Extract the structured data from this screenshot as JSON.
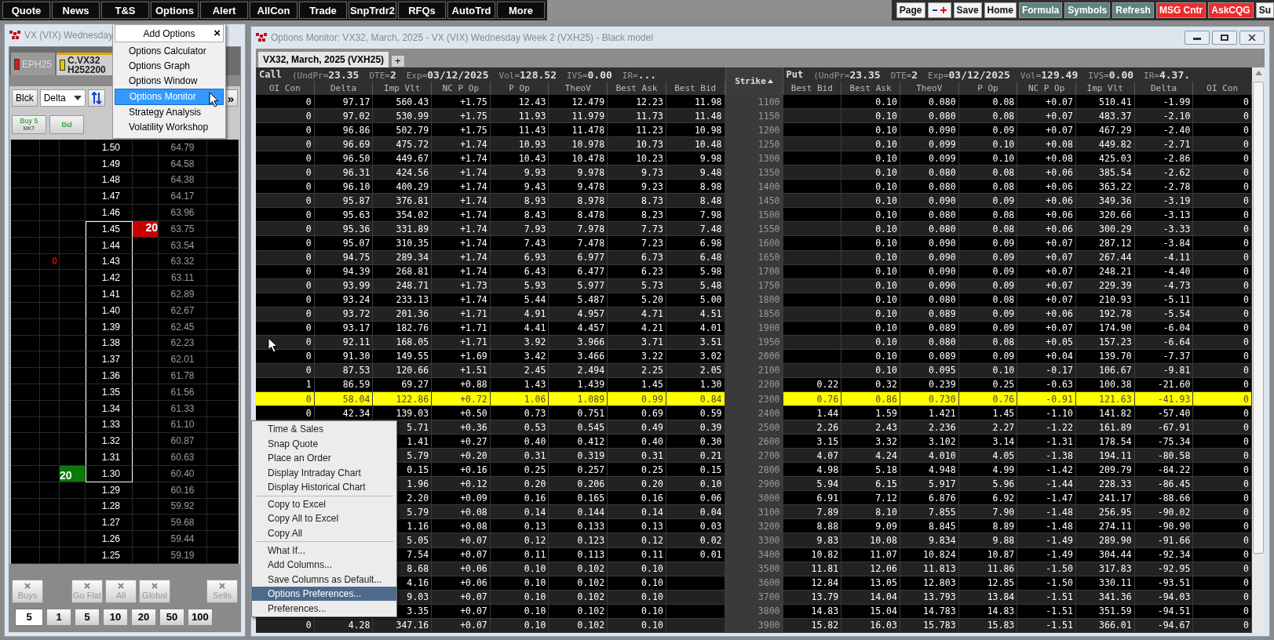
{
  "toolbar": {
    "left": [
      "Quote",
      "News",
      "T&S",
      "Options",
      "Alert",
      "AllCon",
      "Trade",
      "SnpTrdr2",
      "RFQs",
      "AutoTrd",
      "More"
    ],
    "right": [
      {
        "kind": "plain",
        "label": "Page"
      },
      {
        "kind": "plusminus"
      },
      {
        "kind": "plain",
        "label": "Save"
      },
      {
        "kind": "plain",
        "label": "Home"
      },
      {
        "kind": "teal",
        "label": "Formula"
      },
      {
        "kind": "teal",
        "label": "Symbols"
      },
      {
        "kind": "teal",
        "label": "Refresh"
      },
      {
        "kind": "alert",
        "label": "MSG Cntr"
      },
      {
        "kind": "alert",
        "label": "AskCQG"
      },
      {
        "kind": "plain",
        "label": "Su"
      }
    ]
  },
  "dom_window": {
    "title": "VX (VIX) Wednesday",
    "tabs": [
      {
        "label": "EPH25",
        "selected": false,
        "color": "#d02020"
      },
      {
        "label": "C.VX32 H252200",
        "selected": true,
        "color": "#e8c800"
      }
    ],
    "controls": [
      {
        "kind": "button",
        "label": "Blck"
      },
      {
        "kind": "dropdown",
        "label": "Delta"
      },
      {
        "kind": "icon"
      },
      {
        "kind": "more",
        "label": "»"
      }
    ],
    "order_buttons": [
      {
        "label": "Buy 5",
        "sub": "MKT"
      },
      {
        "label": "Bid"
      }
    ],
    "ladder": [
      {
        "price": "1.50",
        "column_6": "64.79",
        "bracketed": false
      },
      {
        "price": "1.49",
        "column_6": "64.58",
        "bracketed": false
      },
      {
        "price": "1.48",
        "column_6": "64.38",
        "bracketed": false
      },
      {
        "price": "1.47",
        "column_6": "64.17",
        "bracketed": false
      },
      {
        "price": "1.46",
        "column_6": "63.96",
        "bracketed": false
      },
      {
        "price": "1.45",
        "sell": "20",
        "column_6": "63.75",
        "bracketed": true
      },
      {
        "price": "1.44",
        "column_6": "63.54",
        "bracketed": true
      },
      {
        "price": "1.43",
        "column_2": "0",
        "column_6": "63.32",
        "bracketed": true
      },
      {
        "price": "1.42",
        "column_6": "63.11",
        "bracketed": true
      },
      {
        "price": "1.41",
        "column_6": "62.89",
        "bracketed": true
      },
      {
        "price": "1.40",
        "column_6": "62.67",
        "bracketed": true
      },
      {
        "price": "1.39",
        "column_6": "62.45",
        "bracketed": true
      },
      {
        "price": "1.38",
        "column_6": "62.23",
        "bracketed": true
      },
      {
        "price": "1.37",
        "column_6": "62.01",
        "bracketed": true
      },
      {
        "price": "1.36",
        "column_6": "61.78",
        "bracketed": true
      },
      {
        "price": "1.35",
        "column_6": "61.56",
        "bracketed": true
      },
      {
        "price": "1.34",
        "column_6": "61.33",
        "bracketed": true
      },
      {
        "price": "1.33",
        "column_6": "61.10",
        "bracketed": true
      },
      {
        "price": "1.32",
        "column_6": "60.87",
        "bracketed": true
      },
      {
        "price": "1.31",
        "column_6": "60.63",
        "bracketed": true
      },
      {
        "price": "1.30",
        "buy": "20",
        "column_6": "60.40",
        "bracketed": true
      },
      {
        "price": "1.29",
        "column_6": "60.16",
        "bracketed": false
      },
      {
        "price": "1.28",
        "column_6": "59.92",
        "bracketed": false
      },
      {
        "price": "1.27",
        "column_6": "59.68",
        "bracketed": false
      },
      {
        "price": "1.26",
        "column_6": "59.44",
        "bracketed": false
      },
      {
        "price": "1.25",
        "column_6": "59.19",
        "bracketed": false
      }
    ],
    "cancel_buttons": [
      "Buys",
      "Go Flat",
      "All",
      "Global",
      "Sells"
    ],
    "quantity": {
      "value": "5"
    },
    "quantity_buttons": [
      "1",
      "5",
      "10",
      "20",
      "50",
      "100"
    ]
  },
  "add_options_menu": {
    "title": "Add Options",
    "close": "×",
    "items": [
      {
        "label": "Options Calculator",
        "selected": false
      },
      {
        "label": "Options Graph",
        "selected": false
      },
      {
        "label": "Options Window",
        "selected": false
      },
      {
        "label": "Options Monitor",
        "selected": true
      },
      {
        "label": "Strategy Analysis",
        "selected": false
      },
      {
        "label": "Volatility Workshop",
        "selected": false
      }
    ]
  },
  "monitor": {
    "title": "Options Monitor: VX32, March, 2025 - VX (VIX) Wednesday Week 2 (VXH25) - Black model",
    "tabs": [
      {
        "label": "VX32, March, 2025 (VXH25)",
        "selected": true
      }
    ],
    "add_tab": "+",
    "call_header": {
      "label": "Call",
      "info": [
        "(UndPr=**23.35**",
        "DTE=**2**",
        "Exp=**03/12/2025**",
        "Vol=**128.52**",
        "IVS=**0.00**",
        "IR=**...**"
      ]
    },
    "put_header": {
      "label": "Put",
      "info": [
        "(UndPr=**23.35**",
        "DTE=**2**",
        "Exp=**03/12/2025**",
        "Vol=**129.49**",
        "IVS=**0.00**",
        "IR=**4.37.**"
      ]
    },
    "call_columns": [
      "OI Con",
      "Delta",
      "Imp Vlt",
      "NC P Op",
      "P Op",
      "TheoV",
      "Best Ask",
      "Best Bid"
    ],
    "strike_column": "Strike",
    "put_columns": [
      "Best Bid",
      "Best Ask",
      "TheoV",
      "P Op",
      "NC P Op",
      "Imp Vlt",
      "Delta",
      "OI Con"
    ],
    "rows": [
      {
        "strike": "1100",
        "atm": false,
        "call": {
          "oi": "0",
          "delta": "97.17",
          "iv": "560.43",
          "ncp": "+1.75",
          "pop": "12.43",
          "theo": "12.479",
          "ask": "12.23",
          "bid": "11.98"
        },
        "put": {
          "ask": "0.10",
          "theo": "0.080",
          "pop": "0.08",
          "ncp": "+0.07",
          "iv": "510.41",
          "delta": "-1.99",
          "oi": "0"
        }
      },
      {
        "strike": "1150",
        "atm": false,
        "call": {
          "oi": "0",
          "delta": "97.02",
          "iv": "530.99",
          "ncp": "+1.75",
          "pop": "11.93",
          "theo": "11.979",
          "ask": "11.73",
          "bid": "11.48"
        },
        "put": {
          "ask": "0.10",
          "theo": "0.080",
          "pop": "0.08",
          "ncp": "+0.07",
          "iv": "483.37",
          "delta": "-2.10",
          "oi": "0"
        }
      },
      {
        "strike": "1200",
        "atm": false,
        "call": {
          "oi": "0",
          "delta": "96.86",
          "iv": "502.79",
          "ncp": "+1.75",
          "pop": "11.43",
          "theo": "11.478",
          "ask": "11.23",
          "bid": "10.98"
        },
        "put": {
          "ask": "0.10",
          "theo": "0.090",
          "pop": "0.09",
          "ncp": "+0.07",
          "iv": "467.29",
          "delta": "-2.40",
          "oi": "0"
        }
      },
      {
        "strike": "1250",
        "atm": false,
        "call": {
          "oi": "0",
          "delta": "96.69",
          "iv": "475.72",
          "ncp": "+1.74",
          "pop": "10.93",
          "theo": "10.978",
          "ask": "10.73",
          "bid": "10.48"
        },
        "put": {
          "ask": "0.10",
          "theo": "0.099",
          "pop": "0.10",
          "ncp": "+0.08",
          "iv": "449.82",
          "delta": "-2.71",
          "oi": "0"
        }
      },
      {
        "strike": "1300",
        "atm": false,
        "call": {
          "oi": "0",
          "delta": "96.50",
          "iv": "449.67",
          "ncp": "+1.74",
          "pop": "10.43",
          "theo": "10.478",
          "ask": "10.23",
          "bid": "9.98"
        },
        "put": {
          "ask": "0.10",
          "theo": "0.099",
          "pop": "0.10",
          "ncp": "+0.08",
          "iv": "425.03",
          "delta": "-2.86",
          "oi": "0"
        }
      },
      {
        "strike": "1350",
        "atm": false,
        "call": {
          "oi": "0",
          "delta": "96.31",
          "iv": "424.56",
          "ncp": "+1.74",
          "pop": "9.93",
          "theo": "9.978",
          "ask": "9.73",
          "bid": "9.48"
        },
        "put": {
          "ask": "0.10",
          "theo": "0.080",
          "pop": "0.08",
          "ncp": "+0.06",
          "iv": "385.54",
          "delta": "-2.62",
          "oi": "0"
        }
      },
      {
        "strike": "1400",
        "atm": false,
        "call": {
          "oi": "0",
          "delta": "96.10",
          "iv": "400.29",
          "ncp": "+1.74",
          "pop": "9.43",
          "theo": "9.478",
          "ask": "9.23",
          "bid": "8.98"
        },
        "put": {
          "ask": "0.10",
          "theo": "0.080",
          "pop": "0.08",
          "ncp": "+0.06",
          "iv": "363.22",
          "delta": "-2.78",
          "oi": "0"
        }
      },
      {
        "strike": "1450",
        "atm": false,
        "call": {
          "oi": "0",
          "delta": "95.87",
          "iv": "376.81",
          "ncp": "+1.74",
          "pop": "8.93",
          "theo": "8.978",
          "ask": "8.73",
          "bid": "8.48"
        },
        "put": {
          "ask": "0.10",
          "theo": "0.090",
          "pop": "0.09",
          "ncp": "+0.06",
          "iv": "349.36",
          "delta": "-3.19",
          "oi": "0"
        }
      },
      {
        "strike": "1500",
        "atm": false,
        "call": {
          "oi": "0",
          "delta": "95.63",
          "iv": "354.02",
          "ncp": "+1.74",
          "pop": "8.43",
          "theo": "8.478",
          "ask": "8.23",
          "bid": "7.98"
        },
        "put": {
          "ask": "0.10",
          "theo": "0.080",
          "pop": "0.08",
          "ncp": "+0.06",
          "iv": "320.66",
          "delta": "-3.13",
          "oi": "0"
        }
      },
      {
        "strike": "1550",
        "atm": false,
        "call": {
          "oi": "0",
          "delta": "95.36",
          "iv": "331.89",
          "ncp": "+1.74",
          "pop": "7.93",
          "theo": "7.978",
          "ask": "7.73",
          "bid": "7.48"
        },
        "put": {
          "ask": "0.10",
          "theo": "0.080",
          "pop": "0.08",
          "ncp": "+0.06",
          "iv": "300.29",
          "delta": "-3.33",
          "oi": "0"
        }
      },
      {
        "strike": "1600",
        "atm": false,
        "call": {
          "oi": "0",
          "delta": "95.07",
          "iv": "310.35",
          "ncp": "+1.74",
          "pop": "7.43",
          "theo": "7.478",
          "ask": "7.23",
          "bid": "6.98"
        },
        "put": {
          "ask": "0.10",
          "theo": "0.090",
          "pop": "0.09",
          "ncp": "+0.07",
          "iv": "287.12",
          "delta": "-3.84",
          "oi": "0"
        }
      },
      {
        "strike": "1650",
        "atm": false,
        "call": {
          "oi": "0",
          "delta": "94.75",
          "iv": "289.34",
          "ncp": "+1.74",
          "pop": "6.93",
          "theo": "6.977",
          "ask": "6.73",
          "bid": "6.48"
        },
        "put": {
          "ask": "0.10",
          "theo": "0.090",
          "pop": "0.09",
          "ncp": "+0.07",
          "iv": "267.44",
          "delta": "-4.11",
          "oi": "0"
        }
      },
      {
        "strike": "1700",
        "atm": false,
        "call": {
          "oi": "0",
          "delta": "94.39",
          "iv": "268.81",
          "ncp": "+1.74",
          "pop": "6.43",
          "theo": "6.477",
          "ask": "6.23",
          "bid": "5.98"
        },
        "put": {
          "ask": "0.10",
          "theo": "0.090",
          "pop": "0.09",
          "ncp": "+0.07",
          "iv": "248.21",
          "delta": "-4.40",
          "oi": "0"
        }
      },
      {
        "strike": "1750",
        "atm": false,
        "call": {
          "oi": "0",
          "delta": "93.99",
          "iv": "248.71",
          "ncp": "+1.73",
          "pop": "5.93",
          "theo": "5.977",
          "ask": "5.73",
          "bid": "5.48"
        },
        "put": {
          "ask": "0.10",
          "theo": "0.090",
          "pop": "0.09",
          "ncp": "+0.07",
          "iv": "229.39",
          "delta": "-4.73",
          "oi": "0"
        }
      },
      {
        "strike": "1800",
        "atm": false,
        "call": {
          "oi": "0",
          "delta": "93.24",
          "iv": "233.13",
          "ncp": "+1.74",
          "pop": "5.44",
          "theo": "5.487",
          "ask": "5.20",
          "bid": "5.00"
        },
        "put": {
          "ask": "0.10",
          "theo": "0.080",
          "pop": "0.08",
          "ncp": "+0.07",
          "iv": "210.93",
          "delta": "-5.11",
          "oi": "0"
        }
      },
      {
        "strike": "1850",
        "atm": false,
        "call": {
          "oi": "0",
          "delta": "93.72",
          "iv": "201.36",
          "ncp": "+1.71",
          "pop": "4.91",
          "theo": "4.957",
          "ask": "4.71",
          "bid": "4.51"
        },
        "put": {
          "ask": "0.10",
          "theo": "0.089",
          "pop": "0.09",
          "ncp": "+0.06",
          "iv": "192.78",
          "delta": "-5.54",
          "oi": "0"
        }
      },
      {
        "strike": "1900",
        "atm": false,
        "call": {
          "oi": "0",
          "delta": "93.17",
          "iv": "182.76",
          "ncp": "+1.71",
          "pop": "4.41",
          "theo": "4.457",
          "ask": "4.21",
          "bid": "4.01"
        },
        "put": {
          "ask": "0.10",
          "theo": "0.089",
          "pop": "0.09",
          "ncp": "+0.07",
          "iv": "174.90",
          "delta": "-6.04",
          "oi": "0"
        }
      },
      {
        "strike": "1950",
        "atm": false,
        "call": {
          "oi": "0",
          "delta": "92.11",
          "iv": "168.05",
          "ncp": "+1.71",
          "pop": "3.92",
          "theo": "3.966",
          "ask": "3.71",
          "bid": "3.51"
        },
        "put": {
          "ask": "0.10",
          "theo": "0.080",
          "pop": "0.08",
          "ncp": "+0.05",
          "iv": "157.23",
          "delta": "-6.64",
          "oi": "0"
        }
      },
      {
        "strike": "2000",
        "atm": false,
        "call": {
          "oi": "0",
          "delta": "91.30",
          "iv": "149.55",
          "ncp": "+1.69",
          "pop": "3.42",
          "theo": "3.466",
          "ask": "3.22",
          "bid": "3.02"
        },
        "put": {
          "ask": "0.10",
          "theo": "0.089",
          "pop": "0.09",
          "ncp": "+0.04",
          "iv": "139.70",
          "delta": "-7.37",
          "oi": "0"
        }
      },
      {
        "strike": "2100",
        "atm": false,
        "call": {
          "oi": "0",
          "delta": "87.53",
          "iv": "120.66",
          "ncp": "+1.51",
          "pop": "2.45",
          "theo": "2.494",
          "ask": "2.25",
          "bid": "2.05"
        },
        "put": {
          "ask": "0.10",
          "theo": "0.095",
          "pop": "0.10",
          "ncp": "-0.17",
          "iv": "106.67",
          "delta": "-9.81",
          "oi": "0"
        }
      },
      {
        "strike": "2200",
        "atm": false,
        "call": {
          "oi": "1",
          "delta": "86.59",
          "iv": "69.27",
          "ncp": "+0.88",
          "pop": "1.43",
          "theo": "1.439",
          "ask": "1.45",
          "bid": "1.30"
        },
        "put": {
          "bid": "0.22",
          "ask": "0.32",
          "theo": "0.239",
          "pop": "0.25",
          "ncp": "-0.63",
          "iv": "100.38",
          "delta": "-21.60",
          "oi": "0"
        }
      },
      {
        "strike": "2300",
        "atm": true,
        "call": {
          "oi": "0",
          "delta": "58.04",
          "iv": "122.86",
          "ncp": "+0.72",
          "pop": "1.06",
          "theo": "1.089",
          "ask": "0.99",
          "bid": "0.84"
        },
        "put": {
          "bid": "0.76",
          "ask": "0.86",
          "theo": "0.730",
          "pop": "0.76",
          "ncp": "-0.91",
          "iv": "121.63",
          "delta": "-41.93",
          "oi": "0"
        }
      },
      {
        "strike": "2400",
        "atm": false,
        "call": {
          "oi": "0",
          "delta": "42.34",
          "iv": "139.03",
          "ncp": "+0.50",
          "pop": "0.73",
          "theo": "0.751",
          "ask": "0.69",
          "bid": "0.59"
        },
        "put": {
          "bid": "1.44",
          "ask": "1.59",
          "theo": "1.421",
          "pop": "1.45",
          "ncp": "-1.10",
          "iv": "141.82",
          "delta": "-57.40",
          "oi": "0"
        }
      },
      {
        "strike": "2500",
        "atm": false,
        "call": {
          "iv": "5.71",
          "ncp": "+0.36",
          "pop": "0.53",
          "theo": "0.545",
          "ask": "0.49",
          "bid": "0.39"
        },
        "put": {
          "bid": "2.26",
          "ask": "2.43",
          "theo": "2.236",
          "pop": "2.27",
          "ncp": "-1.22",
          "iv": "161.89",
          "delta": "-67.91",
          "oi": "0"
        }
      },
      {
        "strike": "2600",
        "atm": false,
        "call": {
          "iv": "1.41",
          "ncp": "+0.27",
          "pop": "0.40",
          "theo": "0.412",
          "ask": "0.40",
          "bid": "0.30"
        },
        "put": {
          "bid": "3.15",
          "ask": "3.32",
          "theo": "3.102",
          "pop": "3.14",
          "ncp": "-1.31",
          "iv": "178.54",
          "delta": "-75.34",
          "oi": "0"
        }
      },
      {
        "strike": "2700",
        "atm": false,
        "call": {
          "iv": "5.79",
          "ncp": "+0.20",
          "pop": "0.31",
          "theo": "0.319",
          "ask": "0.31",
          "bid": "0.21"
        },
        "put": {
          "bid": "4.07",
          "ask": "4.24",
          "theo": "4.010",
          "pop": "4.05",
          "ncp": "-1.38",
          "iv": "194.11",
          "delta": "-80.58",
          "oi": "0"
        }
      },
      {
        "strike": "2800",
        "atm": false,
        "call": {
          "iv": "0.15",
          "ncp": "+0.16",
          "pop": "0.25",
          "theo": "0.257",
          "ask": "0.25",
          "bid": "0.15"
        },
        "put": {
          "bid": "4.98",
          "ask": "5.18",
          "theo": "4.948",
          "pop": "4.99",
          "ncp": "-1.42",
          "iv": "209.79",
          "delta": "-84.22",
          "oi": "0"
        }
      },
      {
        "strike": "2900",
        "atm": false,
        "call": {
          "iv": "1.96",
          "ncp": "+0.12",
          "pop": "0.20",
          "theo": "0.206",
          "ask": "0.20",
          "bid": "0.10"
        },
        "put": {
          "bid": "5.94",
          "ask": "6.15",
          "theo": "5.917",
          "pop": "5.96",
          "ncp": "-1.44",
          "iv": "228.33",
          "delta": "-86.45",
          "oi": "0"
        }
      },
      {
        "strike": "3000",
        "atm": false,
        "call": {
          "iv": "2.20",
          "ncp": "+0.09",
          "pop": "0.16",
          "theo": "0.165",
          "ask": "0.16",
          "bid": "0.06"
        },
        "put": {
          "bid": "6.91",
          "ask": "7.12",
          "theo": "6.876",
          "pop": "6.92",
          "ncp": "-1.47",
          "iv": "241.17",
          "delta": "-88.66",
          "oi": "0"
        }
      },
      {
        "strike": "3100",
        "atm": false,
        "call": {
          "iv": "5.79",
          "ncp": "+0.08",
          "pop": "0.14",
          "theo": "0.144",
          "ask": "0.14",
          "bid": "0.04"
        },
        "put": {
          "bid": "7.89",
          "ask": "8.10",
          "theo": "7.855",
          "pop": "7.90",
          "ncp": "-1.48",
          "iv": "256.95",
          "delta": "-90.02",
          "oi": "0"
        }
      },
      {
        "strike": "3200",
        "atm": false,
        "call": {
          "iv": "1.16",
          "ncp": "+0.08",
          "pop": "0.13",
          "theo": "0.133",
          "ask": "0.13",
          "bid": "0.03"
        },
        "put": {
          "bid": "8.88",
          "ask": "9.09",
          "theo": "8.845",
          "pop": "8.89",
          "ncp": "-1.48",
          "iv": "274.11",
          "delta": "-90.90",
          "oi": "0"
        }
      },
      {
        "strike": "3300",
        "atm": false,
        "call": {
          "iv": "5.05",
          "ncp": "+0.07",
          "pop": "0.12",
          "theo": "0.123",
          "ask": "0.12",
          "bid": "0.02"
        },
        "put": {
          "bid": "9.83",
          "ask": "10.08",
          "theo": "9.834",
          "pop": "9.88",
          "ncp": "-1.49",
          "iv": "289.90",
          "delta": "-91.66",
          "oi": "0"
        }
      },
      {
        "strike": "3400",
        "atm": false,
        "call": {
          "iv": "7.54",
          "ncp": "+0.07",
          "pop": "0.11",
          "theo": "0.113",
          "ask": "0.11",
          "bid": "0.01"
        },
        "put": {
          "bid": "10.82",
          "ask": "11.07",
          "theo": "10.824",
          "pop": "10.87",
          "ncp": "-1.49",
          "iv": "304.44",
          "delta": "-92.34",
          "oi": "0"
        }
      },
      {
        "strike": "3500",
        "atm": false,
        "call": {
          "iv": "8.68",
          "ncp": "+0.06",
          "pop": "0.10",
          "theo": "0.102",
          "ask": "0.10"
        },
        "put": {
          "bid": "11.81",
          "ask": "12.06",
          "theo": "11.813",
          "pop": "11.86",
          "ncp": "-1.50",
          "iv": "317.83",
          "delta": "-92.95",
          "oi": "0"
        }
      },
      {
        "strike": "3600",
        "atm": false,
        "call": {
          "iv": "4.16",
          "ncp": "+0.06",
          "pop": "0.10",
          "theo": "0.102",
          "ask": "0.10"
        },
        "put": {
          "bid": "12.84",
          "ask": "13.05",
          "theo": "12.803",
          "pop": "12.85",
          "ncp": "-1.50",
          "iv": "330.11",
          "delta": "-93.51",
          "oi": "0"
        }
      },
      {
        "strike": "3700",
        "atm": false,
        "call": {
          "iv": "9.03",
          "ncp": "+0.07",
          "pop": "0.10",
          "theo": "0.102",
          "ask": "0.10"
        },
        "put": {
          "bid": "13.79",
          "ask": "14.04",
          "theo": "13.793",
          "pop": "13.84",
          "ncp": "-1.51",
          "iv": "341.36",
          "delta": "-94.03",
          "oi": "0"
        }
      },
      {
        "strike": "3800",
        "atm": false,
        "call": {
          "iv": "3.35",
          "ncp": "+0.07",
          "pop": "0.10",
          "theo": "0.102",
          "ask": "0.10"
        },
        "put": {
          "bid": "14.83",
          "ask": "15.04",
          "theo": "14.783",
          "pop": "14.83",
          "ncp": "-1.51",
          "iv": "351.59",
          "delta": "-94.51",
          "oi": "0"
        }
      },
      {
        "strike": "3900",
        "atm": false,
        "call": {
          "oi": "0",
          "delta": "4.28",
          "iv": "347.16",
          "ncp": "+0.07",
          "pop": "0.10",
          "theo": "0.102",
          "ask": "0.10"
        },
        "put": {
          "bid": "15.82",
          "ask": "16.03",
          "theo": "15.783",
          "pop": "15.83",
          "ncp": "-1.51",
          "iv": "366.01",
          "delta": "-94.67",
          "oi": "0"
        }
      }
    ]
  },
  "context_menu": {
    "groups": [
      [
        {
          "label": "Time & Sales",
          "selected": false
        },
        {
          "label": "Snap Quote",
          "selected": false
        },
        {
          "label": "Place an Order",
          "selected": false
        },
        {
          "label": "Display Intraday Chart",
          "selected": false
        },
        {
          "label": "Display Historical Chart",
          "selected": false
        }
      ],
      [
        {
          "label": "Copy to Excel",
          "selected": false
        },
        {
          "label": "Copy All to Excel",
          "selected": false
        },
        {
          "label": "Copy All",
          "selected": false
        }
      ],
      [
        {
          "label": "What If...",
          "selected": false
        },
        {
          "label": "Add Columns...",
          "selected": false
        },
        {
          "label": "Save Columns as Default...",
          "selected": false
        },
        {
          "label": "Options Preferences...",
          "selected": true
        },
        {
          "label": "Preferences...",
          "selected": false
        }
      ]
    ]
  }
}
